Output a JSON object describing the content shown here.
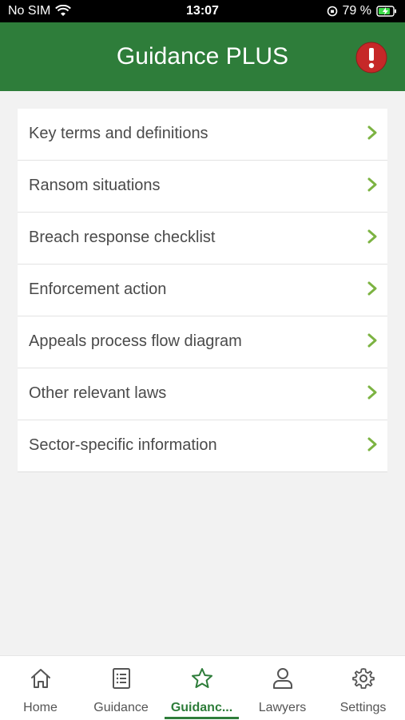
{
  "status_bar": {
    "carrier": "No SIM",
    "time": "13:07",
    "battery_percent": "79 %"
  },
  "header": {
    "title": "Guidance PLUS",
    "alert_icon": "exclamation-circle-icon",
    "alert_color": "#c62828"
  },
  "colors": {
    "brand_green": "#2e7d3a",
    "chevron_green": "#7cb342"
  },
  "list": {
    "items": [
      {
        "label": "Key terms and definitions"
      },
      {
        "label": "Ransom situations"
      },
      {
        "label": "Breach response checklist"
      },
      {
        "label": "Enforcement action"
      },
      {
        "label": "Appeals process flow diagram"
      },
      {
        "label": "Other relevant laws"
      },
      {
        "label": "Sector-specific information"
      }
    ]
  },
  "tabbar": {
    "tabs": [
      {
        "label": "Home",
        "icon": "home-icon"
      },
      {
        "label": "Guidance",
        "icon": "list-document-icon"
      },
      {
        "label": "Guidanc...",
        "icon": "star-icon",
        "active": true
      },
      {
        "label": "Lawyers",
        "icon": "person-icon"
      },
      {
        "label": "Settings",
        "icon": "gear-icon"
      }
    ]
  }
}
